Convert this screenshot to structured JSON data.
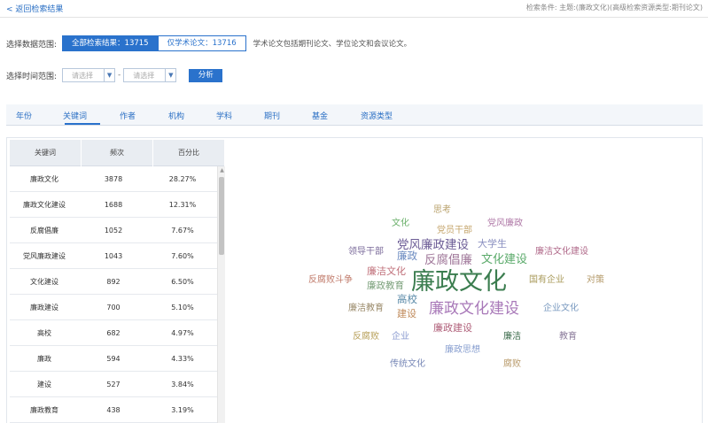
{
  "header": {
    "back_label": "< 返回检索结果",
    "search_condition": "检索条件: 主题:(廉政文化)(高级检索资源类型:期刊论文)"
  },
  "data_range": {
    "label": "选择数据范围:",
    "option_all": "全部检索结果：13715",
    "option_academic": "仅学术论文：13716",
    "note": "学术论文包括期刊论文、学位论文和会议论文。"
  },
  "time_range": {
    "label": "选择时间范围:",
    "start_placeholder": "请选择",
    "end_placeholder": "请选择",
    "separator": "-",
    "analyze_label": "分析"
  },
  "tabs": [
    "年份",
    "关键词",
    "作者",
    "机构",
    "学科",
    "期刊",
    "基金",
    "资源类型"
  ],
  "active_tab": "关键词",
  "table": {
    "headers": [
      "关键词",
      "频次",
      "百分比"
    ],
    "rows": [
      [
        "廉政文化",
        "3878",
        "28.27%"
      ],
      [
        "廉政文化建设",
        "1688",
        "12.31%"
      ],
      [
        "反腐倡廉",
        "1052",
        "7.67%"
      ],
      [
        "党风廉政建设",
        "1043",
        "7.60%"
      ],
      [
        "文化建设",
        "892",
        "6.50%"
      ],
      [
        "廉政建设",
        "700",
        "5.10%"
      ],
      [
        "高校",
        "682",
        "4.97%"
      ],
      [
        "廉政",
        "594",
        "4.33%"
      ],
      [
        "建设",
        "527",
        "3.84%"
      ],
      [
        "廉政教育",
        "438",
        "3.19%"
      ]
    ]
  },
  "colors": {
    "accent": "#2a72cc",
    "header_bg": "#e9edf2"
  },
  "word_cloud": [
    {
      "text": "思考",
      "color": "#b8a06a"
    },
    {
      "text": "文化",
      "color": "#6ab06a"
    },
    {
      "text": "党风廉政",
      "color": "#b07aa8"
    },
    {
      "text": "党员干部",
      "color": "#c4a46a"
    },
    {
      "text": "领导干部",
      "color": "#7a6a9a"
    },
    {
      "text": "党风廉政建设",
      "color": "#6b5b95"
    },
    {
      "text": "大学生",
      "color": "#8a8fc0"
    },
    {
      "text": "廉洁文化建设",
      "color": "#b06a8a"
    },
    {
      "text": "廉政",
      "color": "#6a8ac0"
    },
    {
      "text": "反腐倡廉",
      "color": "#a0789a"
    },
    {
      "text": "文化建设",
      "color": "#5aaa6a"
    },
    {
      "text": "反腐败斗争",
      "color": "#c07a6a"
    },
    {
      "text": "廉洁文化",
      "color": "#c0707a"
    },
    {
      "text": "廉政文化",
      "color": "#3b7d4f"
    },
    {
      "text": "国有企业",
      "color": "#a89a5a"
    },
    {
      "text": "对策",
      "color": "#b49a6a"
    },
    {
      "text": "廉政教育",
      "color": "#7aa07a"
    },
    {
      "text": "高校",
      "color": "#5a8aa8"
    },
    {
      "text": "廉洁教育",
      "color": "#9a8a6a"
    },
    {
      "text": "建设",
      "color": "#c08a5a"
    },
    {
      "text": "廉政文化建设",
      "color": "#a878b8"
    },
    {
      "text": "企业文化",
      "color": "#7a9ac0"
    },
    {
      "text": "廉政建设",
      "color": "#b0607a"
    },
    {
      "text": "反腐败",
      "color": "#b8a05a"
    },
    {
      "text": "企业",
      "color": "#8a9ad0"
    },
    {
      "text": "廉洁",
      "color": "#3a6a4a"
    },
    {
      "text": "教育",
      "color": "#8a7a9a"
    },
    {
      "text": "廉政思想",
      "color": "#8aa0d0"
    },
    {
      "text": "传统文化",
      "color": "#7a8ab8"
    },
    {
      "text": "腐败",
      "color": "#b89a6a"
    }
  ]
}
